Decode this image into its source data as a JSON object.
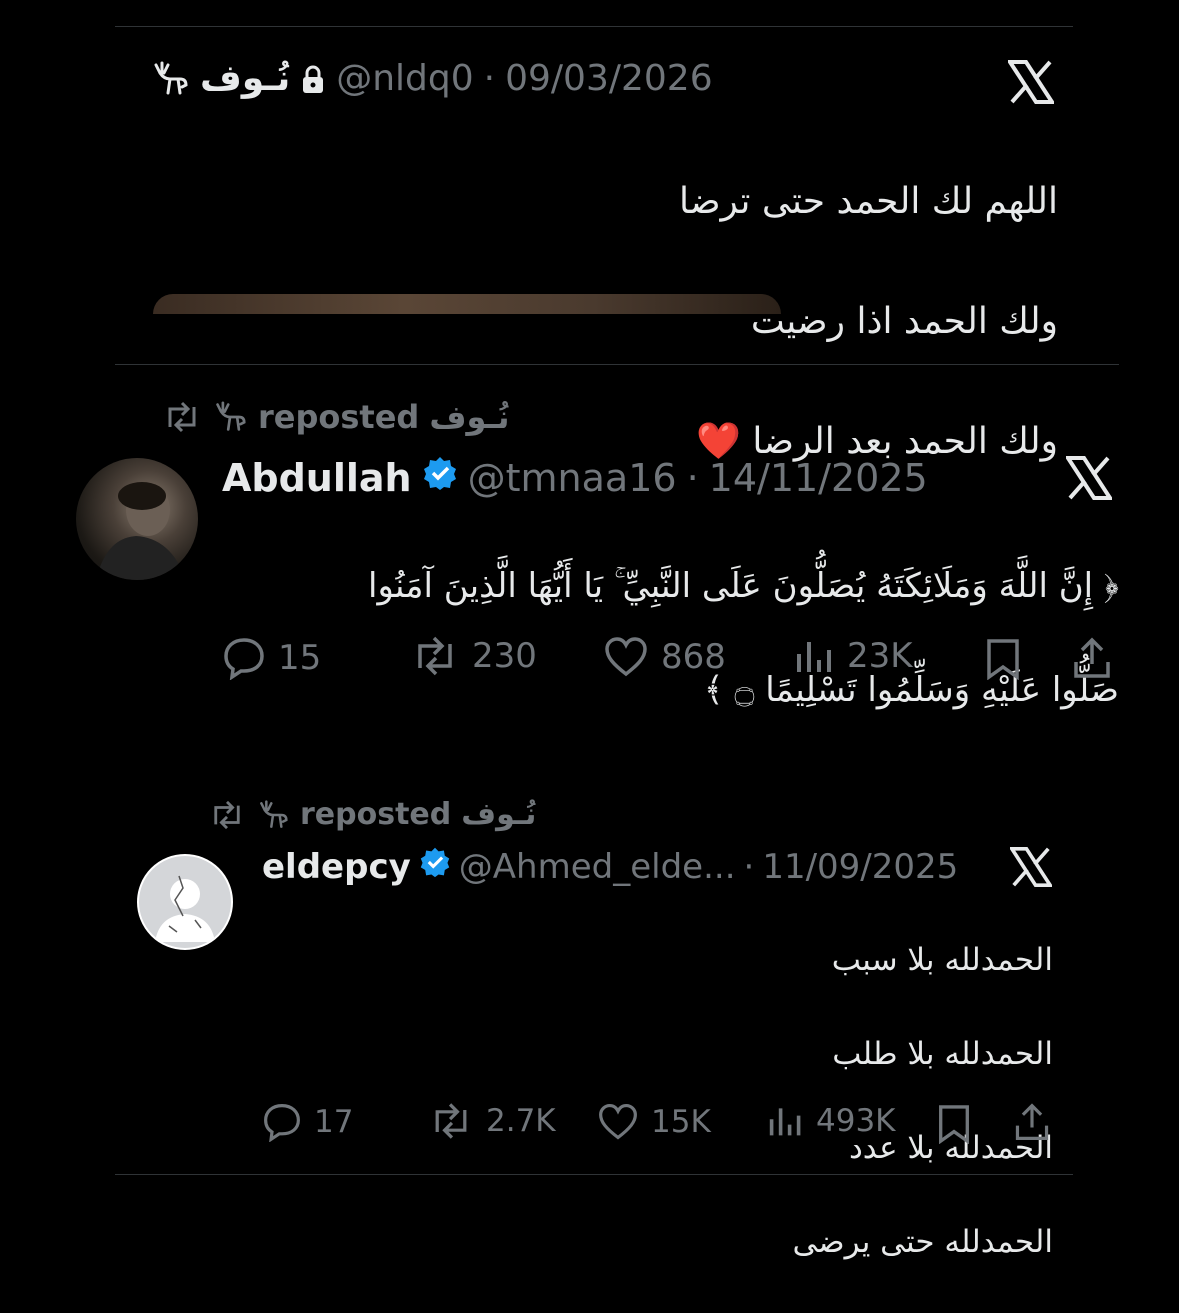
{
  "post1": {
    "name": "نُـوف",
    "handle": "@nldq0",
    "date": "09/03/2026",
    "separator": "·",
    "lines": [
      "اللهم لك الحمد حتى ترضا",
      "ولك الحمد اذا رضيت",
      "ولك الحمد بعد الرضا"
    ],
    "heart": "❤️"
  },
  "post2": {
    "repost_label": "reposted",
    "repost_by": "نُـوف",
    "name": "Abdullah",
    "handle": "@tmnaa16",
    "date": "14/11/2025",
    "separator": "·",
    "text_line1": "﴿ إِنَّ اللَّهَ وَمَلَائِكَتَهُ يُصَلُّونَ عَلَى النَّبِيِّ ۚ يَا أَيُّهَا الَّذِينَ آمَنُوا",
    "text_line2": "صَلُّوا عَلَيْهِ وَسَلِّمُوا تَسْلِيمًا ۝ ﴾",
    "metrics": {
      "replies": "15",
      "reposts": "230",
      "likes": "868",
      "views": "23K"
    }
  },
  "post3": {
    "repost_label": "reposted",
    "repost_by": "نُـوف",
    "name": "eldepcy",
    "handle": "@Ahmed_elde...",
    "date": "11/09/2025",
    "separator": "·",
    "lines": [
      "الحمدلله بلا سبب",
      "الحمدلله بلا طلب",
      "الحمدلله بلا عدد",
      "الحمدلله حتى يرضى"
    ],
    "metrics": {
      "replies": "17",
      "reposts": "2.7K",
      "likes": "15K",
      "views": "493K"
    }
  },
  "colors": {
    "background": "#000000",
    "text": "#e7e9ea",
    "muted": "#71767b",
    "verified": "#1d9bf0",
    "divider": "#2f3336",
    "heart": "#e0245e"
  }
}
